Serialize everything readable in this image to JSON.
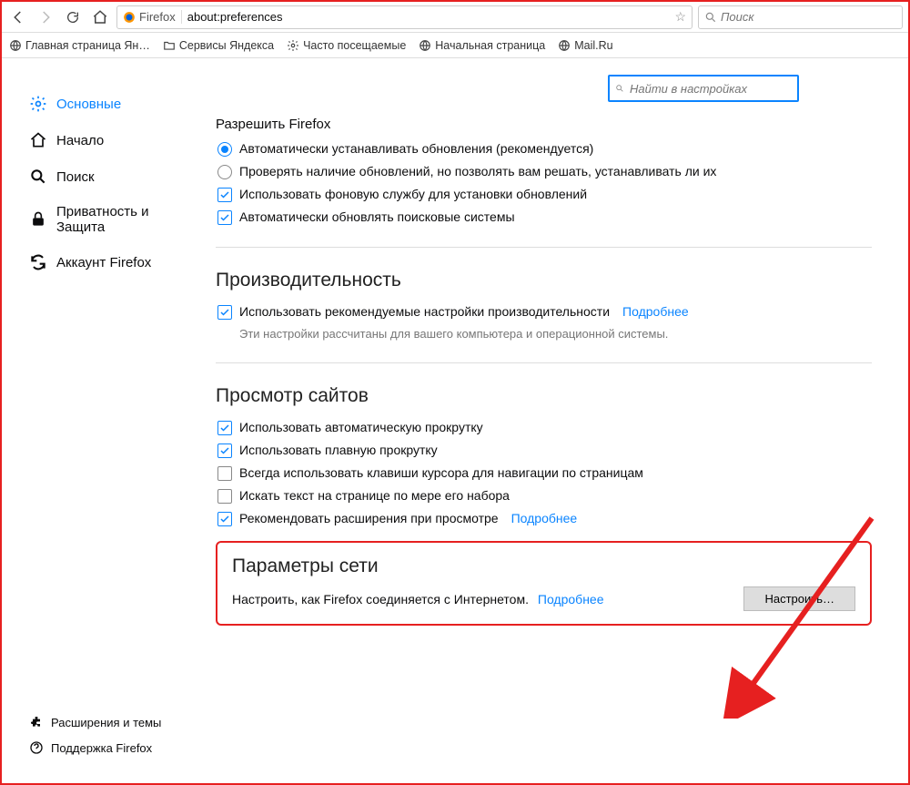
{
  "toolbar": {
    "firefox_label": "Firefox",
    "url": "about:preferences",
    "search_placeholder": "Поиск"
  },
  "bookmarks": [
    "Главная страница Ян…",
    "Сервисы Яндекса",
    "Часто посещаемые",
    "Начальная страница",
    "Mail.Ru"
  ],
  "sidebar": {
    "items": [
      "Основные",
      "Начало",
      "Поиск",
      "Приватность и Защита",
      "Аккаунт Firefox"
    ],
    "bottom": [
      "Расширения и темы",
      "Поддержка Firefox"
    ]
  },
  "find_placeholder": "Найти в настройках",
  "updates": {
    "title": "Разрешить Firefox",
    "radio_auto": "Автоматически устанавливать обновления (рекомендуется)",
    "radio_check": "Проверять наличие обновлений, но позволять вам решать, устанавливать ли их",
    "check_service": "Использовать фоновую службу для установки обновлений",
    "check_search": "Автоматически обновлять поисковые системы"
  },
  "performance": {
    "heading": "Производительность",
    "check_rec": "Использовать рекомендуемые настройки производительности",
    "more": "Подробнее",
    "desc": "Эти настройки рассчитаны для вашего компьютера и операционной системы."
  },
  "browsing": {
    "heading": "Просмотр сайтов",
    "c1": "Использовать автоматическую прокрутку",
    "c2": "Использовать плавную прокрутку",
    "c3": "Всегда использовать клавиши курсора для навигации по страницам",
    "c4": "Искать текст на странице по мере его набора",
    "c5": "Рекомендовать расширения при просмотре",
    "more": "Подробнее"
  },
  "network": {
    "heading": "Параметры сети",
    "desc": "Настроить, как Firefox соединяется с Интернетом.",
    "more": "Подробнее",
    "button": "Настроить…"
  }
}
